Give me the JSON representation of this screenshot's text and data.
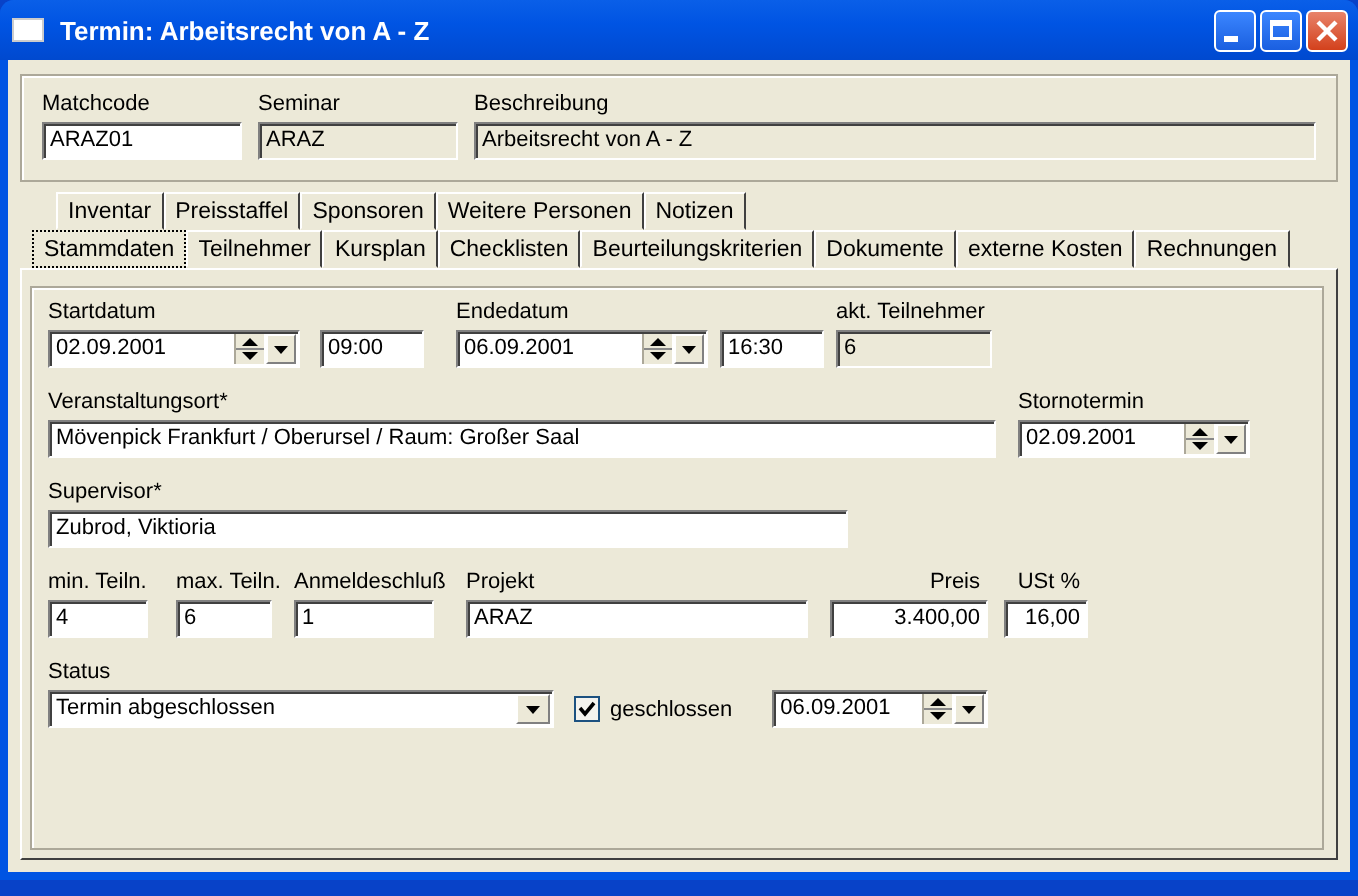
{
  "window": {
    "title": "Termin: Arbeitsrecht von A - Z"
  },
  "header": [
    {
      "label": "Matchcode",
      "value": "ARAZ01",
      "readonly": false
    },
    {
      "label": "Seminar",
      "value": "ARAZ",
      "readonly": true
    },
    {
      "label": "Beschreibung",
      "value": "Arbeitsrecht von A - Z",
      "readonly": true
    }
  ],
  "tab_rows": [
    [
      {
        "label": "Inventar",
        "selected": false
      },
      {
        "label": "Preisstaffel",
        "selected": false
      },
      {
        "label": "Sponsoren",
        "selected": false
      },
      {
        "label": "Weitere Personen",
        "selected": false
      },
      {
        "label": "Notizen",
        "selected": false
      }
    ],
    [
      {
        "label": "Stammdaten",
        "selected": true
      },
      {
        "label": "Teilnehmer",
        "selected": false
      },
      {
        "label": "Kursplan",
        "selected": false
      },
      {
        "label": "Checklisten",
        "selected": false
      },
      {
        "label": "Beurteilungskriterien",
        "selected": false
      },
      {
        "label": "Dokumente",
        "selected": false
      },
      {
        "label": "externe Kosten",
        "selected": false
      },
      {
        "label": "Rechnungen",
        "selected": false
      }
    ]
  ],
  "form": [
    [
      {
        "kind": "date",
        "label": "Startdatum",
        "value": "02.09.2001"
      },
      {
        "kind": "text",
        "value": "09:00"
      },
      {
        "kind": "date",
        "label": "Endedatum",
        "value": "06.09.2001"
      },
      {
        "kind": "text",
        "value": "16:30"
      },
      {
        "kind": "readonly",
        "label": "akt. Teilnehmer",
        "value": "6"
      }
    ],
    [
      {
        "kind": "text",
        "label": "Veranstaltungsort*",
        "value": "Mövenpick Frankfurt / Oberursel / Raum: Großer Saal"
      },
      {
        "kind": "date",
        "label": "Stornotermin",
        "value": "02.09.2001"
      }
    ],
    [
      {
        "kind": "text",
        "label": "Supervisor*",
        "value": "Zubrod, Viktioria"
      }
    ],
    [
      {
        "kind": "text",
        "label": "min. Teiln.",
        "value": "4"
      },
      {
        "kind": "text",
        "label": "max. Teiln.",
        "value": "6"
      },
      {
        "kind": "text",
        "label": "Anmeldeschluß",
        "value": "1"
      },
      {
        "kind": "text",
        "label": "Projekt",
        "value": "ARAZ"
      },
      {
        "kind": "number",
        "label": "Preis",
        "value": "3.400,00"
      },
      {
        "kind": "number",
        "label": "USt %",
        "value": "16,00"
      }
    ],
    [
      {
        "kind": "select",
        "label": "Status",
        "value": "Termin abgeschlossen"
      },
      {
        "kind": "checkbox",
        "label": "geschlossen",
        "checked": true
      },
      {
        "kind": "date",
        "value": "06.09.2001"
      }
    ]
  ]
}
